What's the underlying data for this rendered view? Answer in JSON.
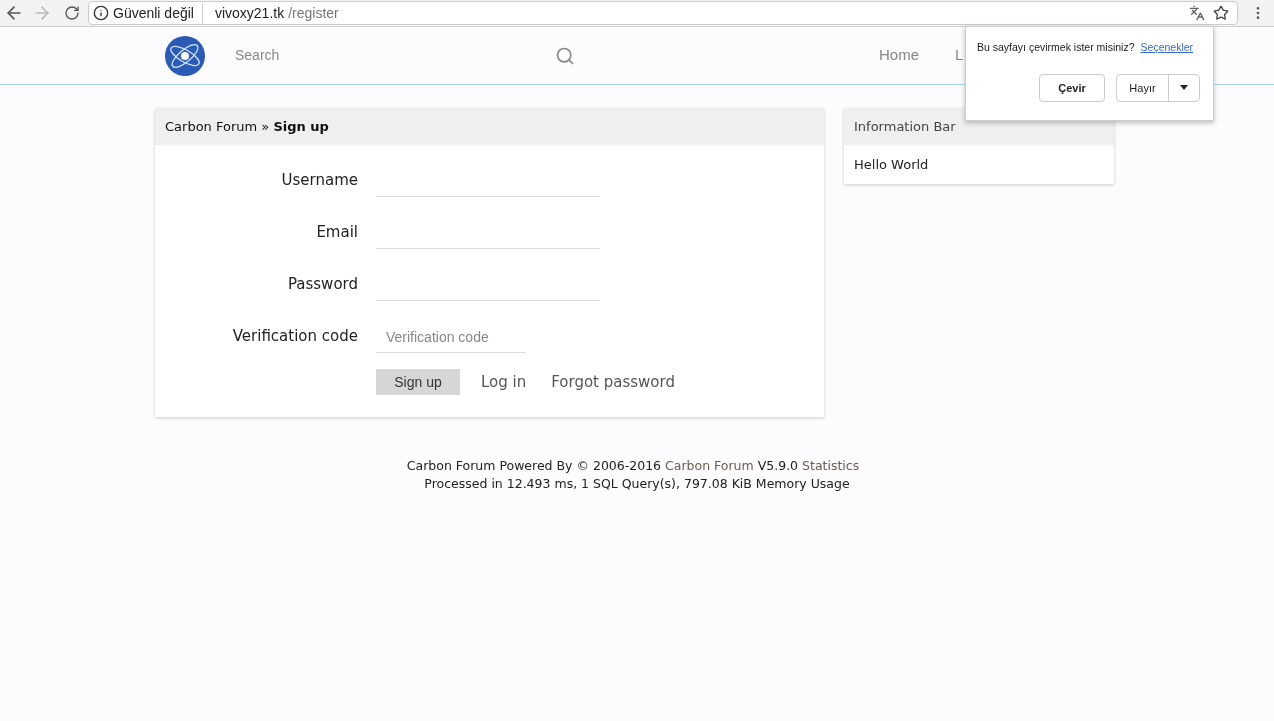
{
  "browser": {
    "security": "Güvenli değil",
    "url_host": "vivoxy21.tk",
    "url_path": "/register"
  },
  "header": {
    "search_placeholder": "Search",
    "nav": [
      "Home",
      "L"
    ]
  },
  "translate_popup": {
    "question": "Bu sayfayı çevirmek ister misiniz?",
    "options_link": "Seçenekler",
    "translate_button": "Çevir",
    "decline_button": "Hayır"
  },
  "signup": {
    "breadcrumb": "Carbon Forum » **Sign up**",
    "fields": [
      {
        "label": "Username",
        "kind": "wide"
      },
      {
        "label": "Email",
        "kind": "wide"
      },
      {
        "label": "Password",
        "kind": "wide"
      },
      {
        "label": "Verification code",
        "placeholder": "Verification code",
        "kind": "narrow"
      }
    ],
    "submit": "Sign up",
    "links": [
      "Log in",
      "Forgot password"
    ]
  },
  "sidebar": {
    "title": "Information Bar",
    "body": "Hello World"
  },
  "footer": {
    "line1": [
      {
        "text": "Carbon Forum Powered By © 2006-2016",
        "kind": "plain"
      },
      {
        "text": "Carbon Forum",
        "kind": "link"
      },
      {
        "text": "V5.9.0",
        "kind": "plain"
      },
      {
        "text": "Statistics",
        "kind": "link"
      }
    ],
    "line2": "Processed in 12.493 ms, 1 SQL Query(s), 797.08 KiB Memory Usage"
  }
}
